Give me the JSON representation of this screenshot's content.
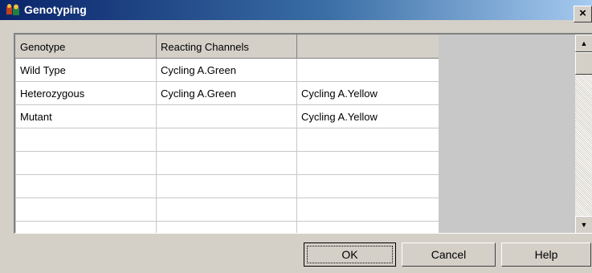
{
  "window": {
    "title": "Genotyping",
    "close_glyph": "×"
  },
  "grid": {
    "headers": [
      "Genotype",
      "Reacting Channels",
      ""
    ],
    "rows": [
      [
        "Wild Type",
        "Cycling A.Green",
        ""
      ],
      [
        "Heterozygous",
        "Cycling A.Green",
        "Cycling A.Yellow"
      ],
      [
        "Mutant",
        "",
        "Cycling A.Yellow"
      ],
      [
        "",
        "",
        ""
      ],
      [
        "",
        "",
        ""
      ],
      [
        "",
        "",
        ""
      ],
      [
        "",
        "",
        ""
      ],
      [
        "",
        "",
        ""
      ]
    ]
  },
  "scrollbar": {
    "up_glyph": "▲",
    "down_glyph": "▼"
  },
  "buttons": {
    "ok_label": "OK",
    "cancel_label": "Cancel",
    "help_label": "Help"
  }
}
